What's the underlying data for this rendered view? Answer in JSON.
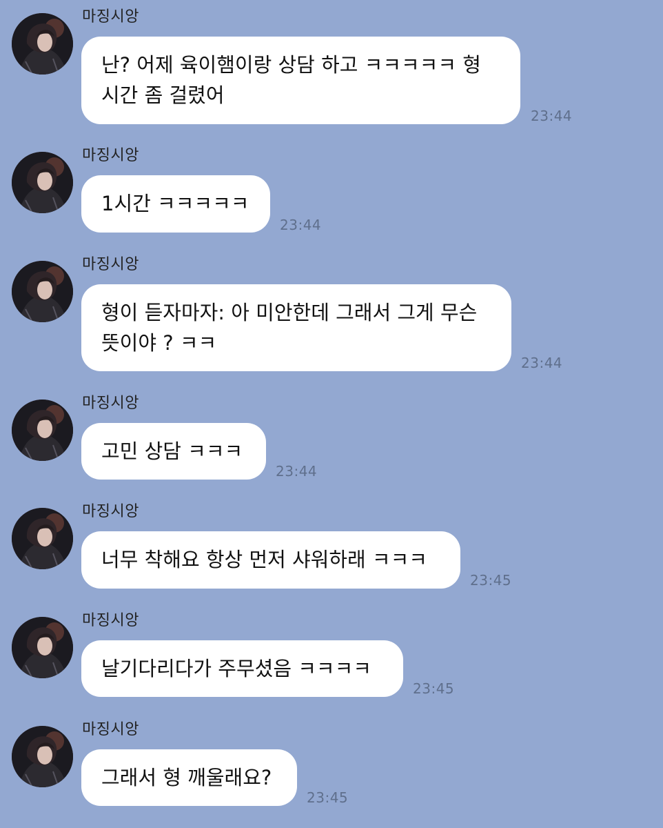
{
  "colors": {
    "background": "#93a8d1",
    "bubble": "#ffffff",
    "time": "#5f6f8c"
  },
  "messages": [
    {
      "sender": "마징시앙",
      "text": "난? 어제 육이햄이랑 상담 하고 ㅋㅋㅋㅋㅋ 형\n시간 좀 걸렸어",
      "time": "23:44"
    },
    {
      "sender": "마징시앙",
      "text": "1시간 ㅋㅋㅋㅋㅋ",
      "time": "23:44"
    },
    {
      "sender": "마징시앙",
      "text": "형이 듣자마자: 아 미안한데 그래서 그게 무슨\n뜻이야 ? ㅋㅋ",
      "time": "23:44"
    },
    {
      "sender": "마징시앙",
      "text": "고민 상담 ㅋㅋㅋ",
      "time": "23:44"
    },
    {
      "sender": "마징시앙",
      "text": "너무 착해요 항상 먼저 샤워하래 ㅋㅋㅋ",
      "time": "23:45"
    },
    {
      "sender": "마징시앙",
      "text": "날기다리다가 주무셨음 ㅋㅋㅋㅋ",
      "time": "23:45"
    },
    {
      "sender": "마징시앙",
      "text": "그래서 형 깨울래요?",
      "time": "23:45"
    }
  ]
}
